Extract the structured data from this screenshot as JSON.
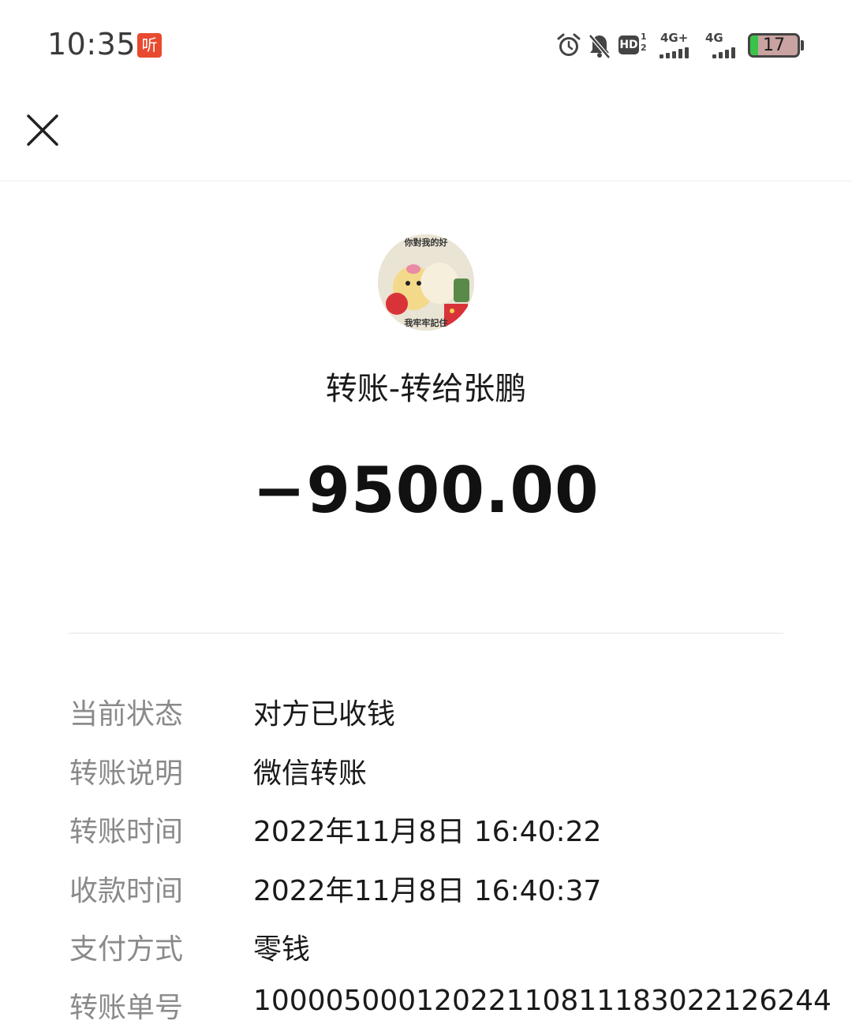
{
  "status_bar": {
    "time": "10:35",
    "listen_badge": "听",
    "hd_label": "HD",
    "hd_sub": "1\n2",
    "network_1": "4G+",
    "network_2": "4G",
    "battery": "17",
    "battery_level_percent": 17,
    "icons": [
      "alarm-icon",
      "bell-muted-icon",
      "hd-icon",
      "signal-icon",
      "signal-icon",
      "battery-icon"
    ]
  },
  "nav": {
    "close_icon": "close-icon"
  },
  "avatar": {
    "caption_top": "你對我的好",
    "caption_bottom": "我牢牢記住"
  },
  "transfer": {
    "title": "转账-转给张鹏",
    "amount": "−9500.00"
  },
  "details": [
    {
      "label": "当前状态",
      "value": "对方已收钱"
    },
    {
      "label": "转账说明",
      "value": "微信转账"
    },
    {
      "label": "转账时间",
      "value": "2022年11月8日 16:40:22"
    },
    {
      "label": "收款时间",
      "value": "2022年11月8日 16:40:37"
    },
    {
      "label": "支付方式",
      "value": "零钱"
    },
    {
      "label": "转账单号",
      "value": "10000500012022110811183022126244"
    }
  ],
  "colors": {
    "listen_badge": "#e84a2f",
    "battery_fill": "#3bc24a",
    "label_gray": "#8a8a8a",
    "text_dark": "#1a1a1a"
  }
}
